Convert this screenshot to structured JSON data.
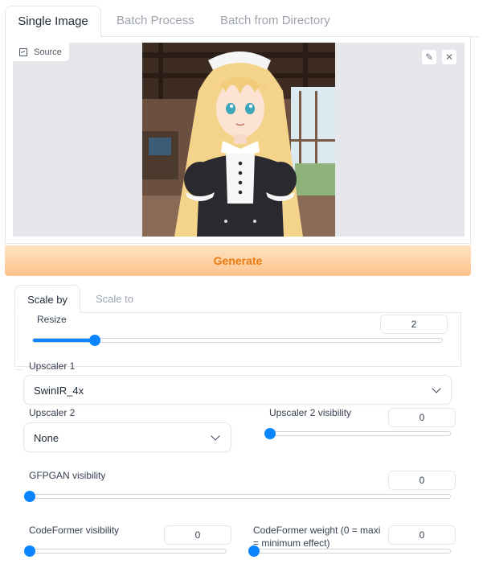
{
  "tabs": [
    "Single Image",
    "Batch Process",
    "Batch from Directory"
  ],
  "source": {
    "label": "Source",
    "edit_icon": "pencil-icon",
    "close_icon": "close-icon"
  },
  "generate": {
    "label": "Generate"
  },
  "scale_tabs": [
    "Scale by",
    "Scale to"
  ],
  "resize": {
    "label": "Resize",
    "value": "2",
    "fraction": 0.16
  },
  "upscaler1": {
    "label": "Upscaler 1",
    "value": "SwinIR_4x"
  },
  "upscaler2": {
    "label": "Upscaler 2",
    "value": "None"
  },
  "upscaler2_visibility": {
    "label": "Upscaler 2 visibility",
    "value": "0"
  },
  "gfpgan": {
    "label": "GFPGAN visibility",
    "value": "0"
  },
  "codeformer_visibility": {
    "label": "CodeFormer visibility",
    "value": "0"
  },
  "codeformer_weight": {
    "label_line1": "CodeFormer weight (0 = maxi",
    "label_line2": "= minimum effect)",
    "value": "0"
  },
  "colors": {
    "accent": "#0a84ff",
    "generate_text": "#ea7a12",
    "generate_bg_top": "#ffe3c2",
    "generate_bg_bottom": "#fdc38a"
  }
}
